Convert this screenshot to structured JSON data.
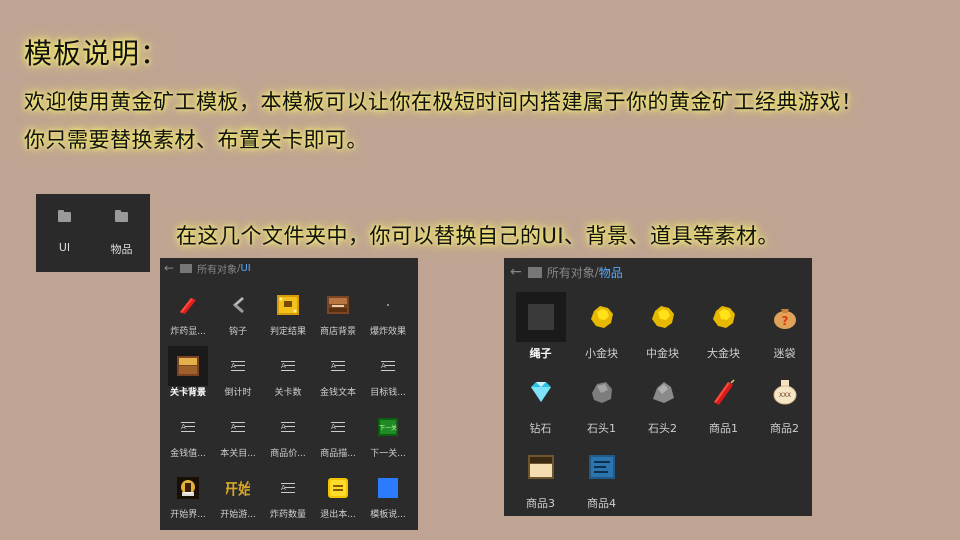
{
  "title": "模板说明：",
  "line1": "欢迎使用黄金矿工模板，本模板可以让你在极短时间内搭建属于你的黄金矿工经典游戏！",
  "line2": "你只需要替换素材、布置关卡即可。",
  "caption": "在这几个文件夹中，你可以替换自己的UI、背景、道具等素材。",
  "folders": [
    {
      "label": "UI"
    },
    {
      "label": "物品"
    }
  ],
  "panel_ui": {
    "crumb_root": "所有对象",
    "crumb_sep": "/",
    "crumb_current": "UI",
    "items": [
      {
        "label": "炸药显...",
        "icon": "dynamite-red-icon"
      },
      {
        "label": "钩子",
        "icon": "hook-icon"
      },
      {
        "label": "判定结果",
        "icon": "result-badge-icon"
      },
      {
        "label": "商店背景",
        "icon": "shop-background-icon"
      },
      {
        "label": "爆炸效果",
        "icon": "explosion-dot-icon"
      },
      {
        "label": "关卡背景",
        "icon": "level-background-icon"
      },
      {
        "label": "倒计时",
        "icon": "text-object-icon"
      },
      {
        "label": "关卡数",
        "icon": "text-object-icon"
      },
      {
        "label": "金钱文本",
        "icon": "text-object-icon"
      },
      {
        "label": "目标钱...",
        "icon": "text-object-icon"
      },
      {
        "label": "金钱值...",
        "icon": "text-object-icon"
      },
      {
        "label": "本关目...",
        "icon": "text-object-icon"
      },
      {
        "label": "商品价...",
        "icon": "text-object-icon"
      },
      {
        "label": "商品描...",
        "icon": "text-object-icon"
      },
      {
        "label": "下一关...",
        "icon": "next-level-button-icon"
      },
      {
        "label": "开始界...",
        "icon": "start-screen-icon"
      },
      {
        "label": "开始游...",
        "icon": "start-game-text-icon"
      },
      {
        "label": "炸药数量",
        "icon": "text-object-icon"
      },
      {
        "label": "退出本...",
        "icon": "exit-button-icon"
      },
      {
        "label": "模板说...",
        "icon": "blue-square-icon"
      }
    ]
  },
  "panel_items": {
    "crumb_root": "所有对象",
    "crumb_sep": "/",
    "crumb_current": "物品",
    "items": [
      {
        "label": "绳子",
        "icon": "rope-icon"
      },
      {
        "label": "小金块",
        "icon": "gold-nugget-icon"
      },
      {
        "label": "中金块",
        "icon": "gold-nugget-icon"
      },
      {
        "label": "大金块",
        "icon": "gold-nugget-icon"
      },
      {
        "label": "迷袋",
        "icon": "mystery-bag-icon"
      },
      {
        "label": "钻石",
        "icon": "diamond-icon"
      },
      {
        "label": "石头1",
        "icon": "stone-icon"
      },
      {
        "label": "石头2",
        "icon": "stone-icon"
      },
      {
        "label": "商品1",
        "icon": "dynamite-icon"
      },
      {
        "label": "商品2",
        "icon": "potion-jar-icon"
      },
      {
        "label": "商品3",
        "icon": "box-item-icon"
      },
      {
        "label": "商品4",
        "icon": "book-item-icon"
      }
    ]
  },
  "colors": {
    "background": "#bfa493",
    "panel": "#2b2b2b",
    "link": "#5aa9ff",
    "gold": "#f2d200"
  }
}
